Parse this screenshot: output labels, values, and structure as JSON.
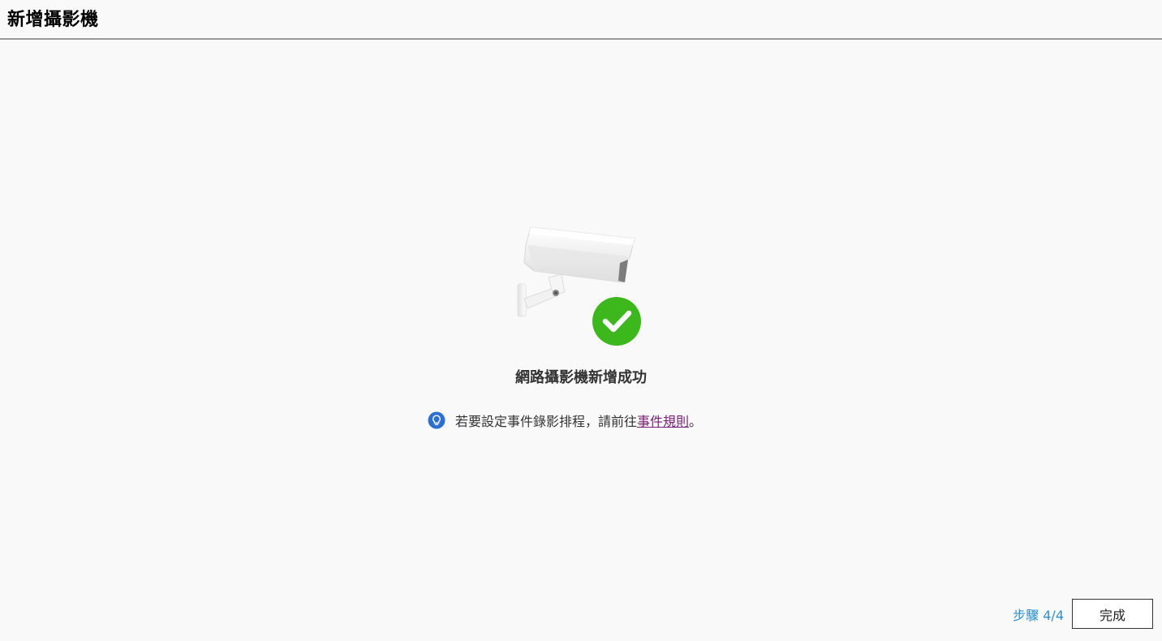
{
  "header": {
    "title": "新增攝影機"
  },
  "main": {
    "success_message": "網路攝影機新增成功",
    "hint": {
      "text_before": "若要設定事件錄影排程，請前往 ",
      "link_text": "事件規則",
      "text_after": "。",
      "icon": "lightbulb-icon"
    },
    "illustration_icons": [
      "camera-icon",
      "check-circle-icon"
    ]
  },
  "footer": {
    "step_label": "步驟 4/4",
    "done_label": "完成"
  },
  "colors": {
    "success_green": "#3cb81c",
    "hint_blue": "#2b6fd6",
    "link_purple": "#7a1f7a",
    "step_blue": "#2a8fd8"
  }
}
